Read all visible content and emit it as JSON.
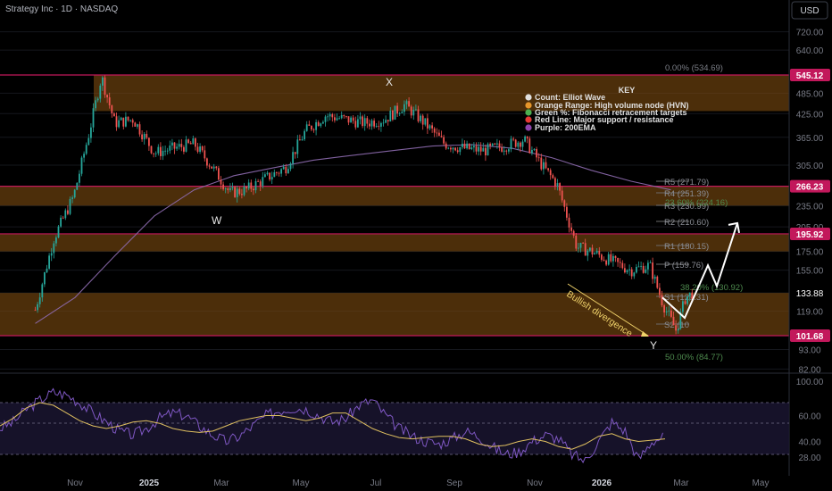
{
  "header": {
    "title": "Strategy Inc · 1D · NASDAQ",
    "currency": "USD"
  },
  "price_axis": {
    "ticks": [
      "720.00",
      "640.00",
      "545.12",
      "485.00",
      "425.00",
      "365.00",
      "305.00",
      "266.23",
      "235.00",
      "205.00",
      "195.92",
      "175.00",
      "155.00",
      "133.88",
      "119.00",
      "101.68",
      "93.00",
      "82.00"
    ],
    "highlighted": [
      {
        "label": "545.12",
        "color": "#c2185b"
      },
      {
        "label": "266.23",
        "color": "#c2185b"
      },
      {
        "label": "195.92",
        "color": "#c2185b"
      },
      {
        "label": "133.88",
        "color": "#000000"
      },
      {
        "label": "101.68",
        "color": "#c2185b"
      }
    ]
  },
  "rsi_axis": {
    "ticks": [
      "100.00",
      "60.00",
      "40.00",
      "28.00"
    ]
  },
  "time_axis": {
    "ticks": [
      "Nov",
      "2025",
      "Mar",
      "May",
      "Jul",
      "Sep",
      "Nov",
      "2026",
      "Mar",
      "May"
    ]
  },
  "key_legend": {
    "title": "KEY",
    "items": [
      {
        "color": "#e0e0e0",
        "text": "Count: Elliot Wave"
      },
      {
        "color": "#e6962b",
        "text": "Orange Range: High volume node (HVN)"
      },
      {
        "color": "#4caf50",
        "text": "Green %: Fibonacci retracement targets"
      },
      {
        "color": "#e53935",
        "text": "Red Line: Major support / resistance"
      },
      {
        "color": "#8e44ad",
        "text": "Purple: 200EMA"
      }
    ]
  },
  "annotations": {
    "wave_w": "W",
    "wave_x": "X",
    "wave_y": "Y",
    "divergence": "Bullish divergence",
    "fib_0": "0.00% (534.69)",
    "fib_236": "23.60% (224.16)",
    "fib_382": "38.20% (130.92)",
    "fib_50": "50.00% (84.77)"
  },
  "pivots": [
    {
      "label": "R5 (271.79)"
    },
    {
      "label": "R4 (251.39)"
    },
    {
      "label": "R3 (230.99)"
    },
    {
      "label": "R2 (210.60)"
    },
    {
      "label": "R1 (180.15)"
    },
    {
      "label": "P (159.76)"
    },
    {
      "label": "S1 (129.31)"
    },
    {
      "label": "S2 (10"
    }
  ],
  "chart_data": {
    "type": "candlestick",
    "title": "Strategy Inc · 1D · NASDAQ",
    "yscale": "log",
    "ylim": [
      82,
      760
    ],
    "x_ticks": [
      "Nov",
      "2025",
      "Mar",
      "May",
      "Jul",
      "Sep",
      "Nov",
      "2026",
      "Mar",
      "May"
    ],
    "hvn_zones": [
      [
        432,
        545.12
      ],
      [
        235,
        266.23
      ],
      [
        175,
        195.92
      ],
      [
        101.68,
        133.88
      ]
    ],
    "support_resistance": [
      545.12,
      266.23,
      195.92,
      101.68
    ],
    "price_path": [
      [
        "Oct 1",
        120
      ],
      [
        "Oct 15",
        190
      ],
      [
        "Oct 30",
        250
      ],
      [
        "Nov 12",
        380
      ],
      [
        "Nov 21",
        540
      ],
      [
        "Dec 1",
        400
      ],
      [
        "Dec 15",
        410
      ],
      [
        "Dec 31",
        330
      ],
      [
        "Jan 15",
        340
      ],
      [
        "Feb 1",
        350
      ],
      [
        "Feb 15",
        300
      ],
      [
        "Feb 28",
        255
      ],
      [
        "Mar 10",
        260
      ],
      [
        "Mar 25",
        280
      ],
      [
        "Apr 10",
        300
      ],
      [
        "Apr 25",
        380
      ],
      [
        "May 10",
        420
      ],
      [
        "May 25",
        410
      ],
      [
        "Jun 10",
        400
      ],
      [
        "Jun 25",
        410
      ],
      [
        "Jul 10",
        450
      ],
      [
        "Jul 25",
        400
      ],
      [
        "Aug 10",
        350
      ],
      [
        "Aug 25",
        340
      ],
      [
        "Sep 10",
        335
      ],
      [
        "Sep 25",
        345
      ],
      [
        "Oct 10",
        360
      ],
      [
        "Oct 25",
        300
      ],
      [
        "Nov 5",
        270
      ],
      [
        "Nov 20",
        180
      ],
      [
        "Dec 1",
        175
      ],
      [
        "Dec 15",
        165
      ],
      [
        "Dec 31",
        155
      ],
      [
        "Jan 15",
        160
      ],
      [
        "Jan 25",
        125
      ],
      [
        "Feb 5",
        105
      ],
      [
        "Feb 12",
        130
      ],
      [
        "Feb 18",
        134
      ]
    ],
    "ema200": [
      [
        "Oct 1",
        110
      ],
      [
        "Nov 1",
        130
      ],
      [
        "Dec 1",
        170
      ],
      [
        "Jan 1",
        220
      ],
      [
        "Feb 1",
        260
      ],
      [
        "Mar 1",
        285
      ],
      [
        "Apr 1",
        300
      ],
      [
        "May 1",
        315
      ],
      [
        "Jun 1",
        325
      ],
      [
        "Jul 1",
        335
      ],
      [
        "Aug 1",
        345
      ],
      [
        "Sep 1",
        348
      ],
      [
        "Oct 1",
        340
      ],
      [
        "Nov 1",
        320
      ],
      [
        "Dec 1",
        295
      ],
      [
        "Jan 1",
        275
      ],
      [
        "Feb 1",
        260
      ]
    ],
    "projection": [
      [
        "Feb 18",
        130
      ],
      [
        "Feb 28",
        114
      ],
      [
        "Mar 10",
        160
      ],
      [
        "Mar 20",
        140
      ],
      [
        "Apr 5",
        210
      ]
    ],
    "rsi_ylim": [
      20,
      100
    ],
    "rsi_levels": [
      70,
      50,
      30
    ],
    "rsi": [
      50,
      55,
      65,
      72,
      78,
      76,
      70,
      62,
      55,
      48,
      45,
      50,
      58,
      62,
      60,
      52,
      45,
      40,
      44,
      52,
      60,
      64,
      66,
      65,
      60,
      55,
      58,
      68,
      72,
      60,
      50,
      44,
      40,
      38,
      42,
      48,
      44,
      36,
      30,
      32,
      40,
      45,
      42,
      30,
      25,
      40,
      55,
      48,
      26,
      40,
      44
    ],
    "rsi_ma": [
      52,
      58,
      66,
      70,
      68,
      62,
      56,
      52,
      50,
      52,
      55,
      56,
      54,
      50,
      48,
      47,
      48,
      52,
      56,
      58,
      60,
      60,
      58,
      56,
      58,
      62,
      62,
      56,
      50,
      46,
      43,
      42,
      43,
      44,
      44,
      42,
      38,
      36,
      37,
      40,
      42,
      40,
      36,
      34,
      38,
      44,
      46,
      42,
      40,
      41,
      42
    ]
  }
}
